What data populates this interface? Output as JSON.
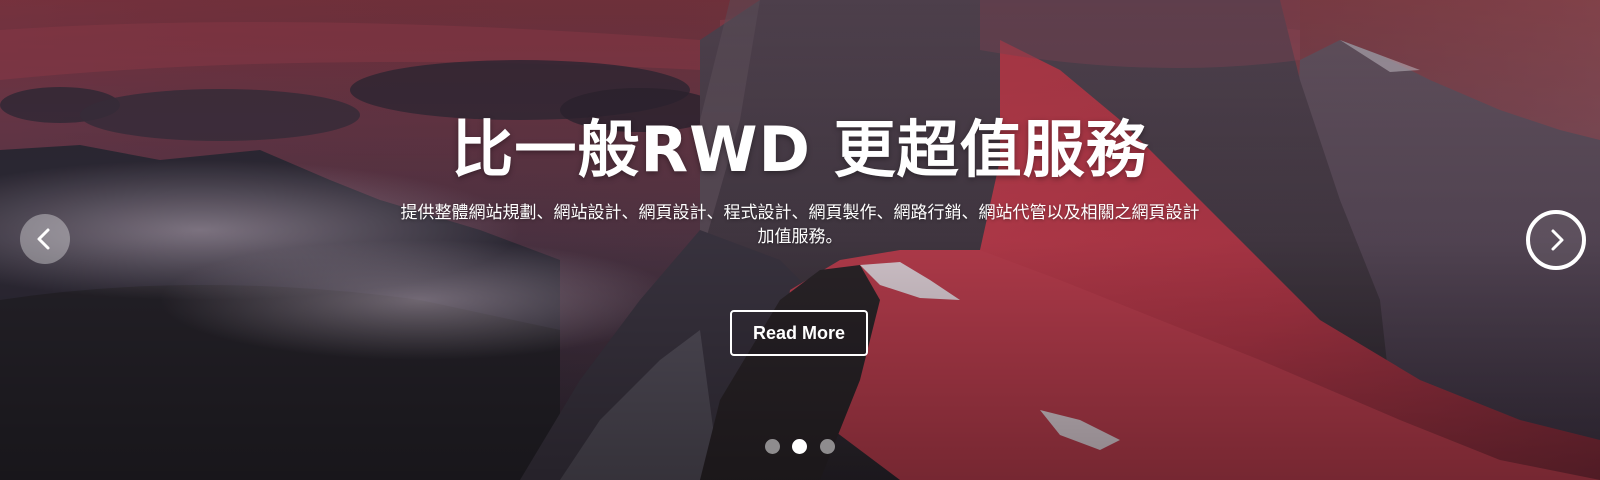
{
  "hero": {
    "headline": "比一般RWD 更超值服務",
    "description": "提供整體網站規劃、網站設計、網頁設計、程式設計、網頁製作、網路行銷、網站代管以及相關之網頁設計加值服務。",
    "button_label": "Read More"
  },
  "carousel": {
    "prev_icon": "chevron-left-icon",
    "next_icon": "chevron-right-icon",
    "slide_count": 3,
    "active_slide": 2
  },
  "colors": {
    "text": "#ffffff",
    "sky_top": "#7a3a4a",
    "ridge_red": "#b03848",
    "mountain_dark": "#2e2832"
  }
}
